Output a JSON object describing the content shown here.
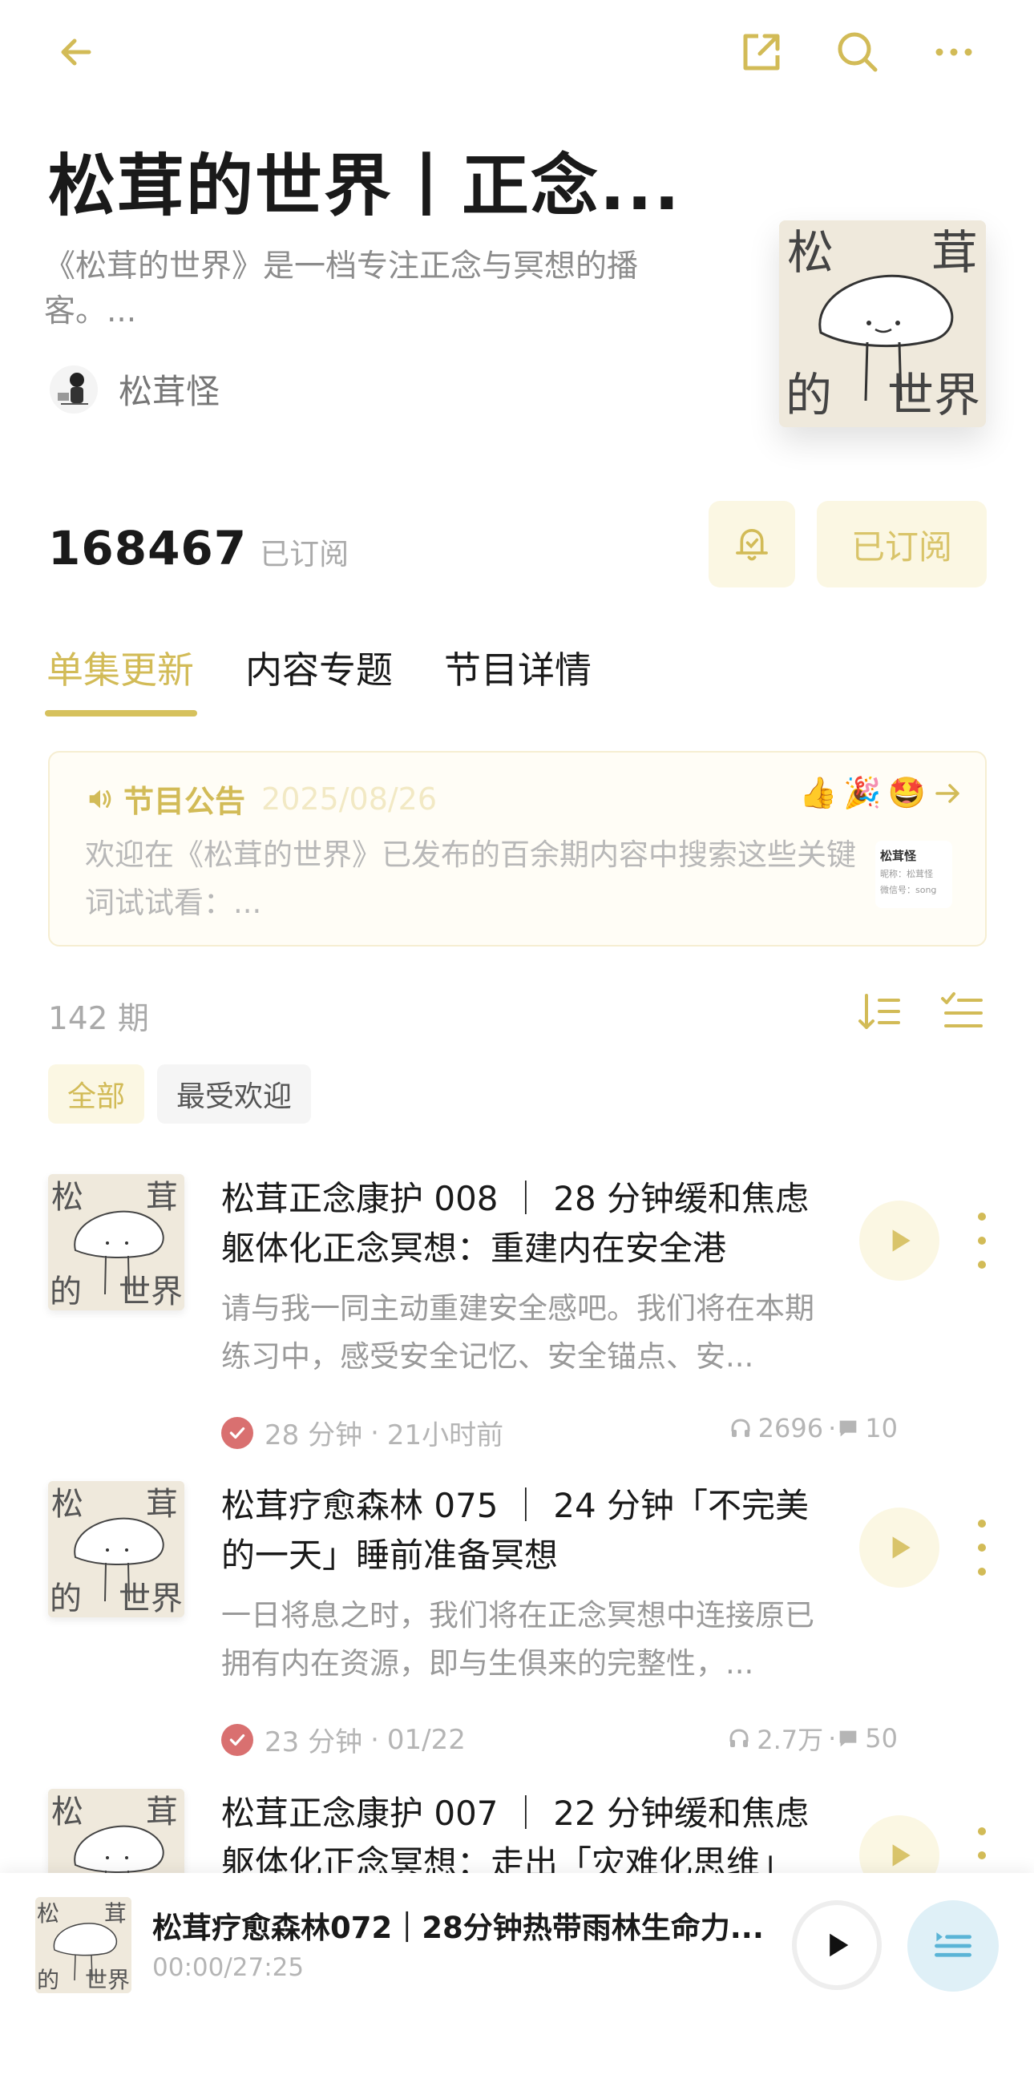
{
  "header": {
    "title": "松茸的世界丨正念...",
    "description": "《松茸的世界》是一档专注正念与冥想的播客。...",
    "author": "松茸怪",
    "cover_text": [
      "松",
      "茸",
      "的",
      "世界"
    ]
  },
  "subscription": {
    "count": "168467",
    "count_label": "已订阅",
    "subscribe_button": "已订阅"
  },
  "tabs": [
    {
      "label": "单集更新",
      "active": true
    },
    {
      "label": "内容专题",
      "active": false
    },
    {
      "label": "节目详情",
      "active": false
    }
  ],
  "notice": {
    "title": "节目公告",
    "date": "2025/08/26",
    "text": "欢迎在《松茸的世界》已发布的百余期内容中搜索这些关键词试试看：...",
    "thumb_title": "松茸怪",
    "thumb_line1": "昵称：松茸怪",
    "thumb_line2": "微信号：song"
  },
  "episode_count": "142 期",
  "filters": [
    {
      "label": "全部",
      "active": true
    },
    {
      "label": "最受欢迎",
      "active": false
    }
  ],
  "episodes": [
    {
      "title": "松茸正念康护 008 ｜ 28 分钟缓和焦虑躯体化正念冥想：重建内在安全港",
      "desc": "请与我一同主动重建安全感吧。我们将在本期练习中，感受安全记忆、安全锚点、安...",
      "duration": "28 分钟",
      "time": "21小时前",
      "plays": "2696",
      "comments": "10"
    },
    {
      "title": "松茸疗愈森林 075 ｜ 24 分钟「不完美的一天」睡前准备冥想",
      "desc": "一日将息之时，我们将在正念冥想中连接原已拥有内在资源，即与生俱来的完整性，...",
      "duration": "23 分钟",
      "time": "01/22",
      "plays": "2.7万",
      "comments": "50"
    },
    {
      "title": "松茸正念康护 007 ｜ 22 分钟缓和焦虑躯体化正念冥想：走出「灾难化思维」",
      "desc": "",
      "duration": "",
      "time": "",
      "plays": "",
      "comments": ""
    }
  ],
  "player": {
    "title": "松茸疗愈森林072｜28分钟热带雨林生命力...",
    "time": "00:00/27:25"
  },
  "colors": {
    "accent": "#d2bb57",
    "accent_bg": "#fbf7e3",
    "check": "#d97070",
    "playlist_bg": "#dff0f7",
    "playlist_icon": "#5ab4d6"
  }
}
